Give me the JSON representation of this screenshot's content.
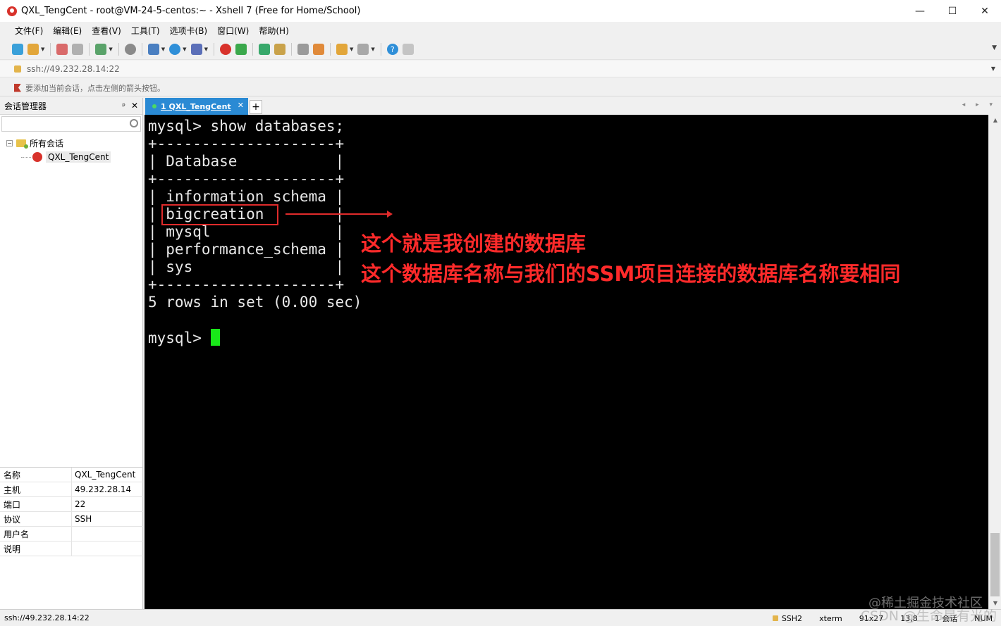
{
  "window": {
    "title": "QXL_TengCent - root@VM-24-5-centos:~ - Xshell 7 (Free for Home/School)",
    "controls": [
      "—",
      "☐",
      "✕"
    ]
  },
  "menu": [
    "文件(F)",
    "编辑(E)",
    "查看(V)",
    "工具(T)",
    "选项卡(B)",
    "窗口(W)",
    "帮助(H)"
  ],
  "toolbar": {
    "icons": [
      "new-session-icon",
      "open-folder-icon",
      "disconnect-icon",
      "reconnect-icon",
      "session-settings-icon",
      "find-icon",
      "transfer-icon",
      "globe-icon",
      "font-icon",
      "xftp-icon",
      "xmanager-icon",
      "fullscreen-icon",
      "lock-icon",
      "keyboard-icon",
      "highlight-icon",
      "new-tab-icon",
      "layout-icon",
      "help-icon",
      "chat-icon"
    ],
    "accent": "#2a8ad4"
  },
  "address": {
    "value": "ssh://49.232.28.14:22"
  },
  "hint": {
    "text": "要添加当前会话，点击左侧的箭头按钮。"
  },
  "session_manager": {
    "title": "会话管理器",
    "pin": "ᵖ",
    "close": "✕",
    "search_placeholder": "",
    "tree": {
      "root": "所有会话",
      "toggle": "−",
      "session": "QXL_TengCent"
    },
    "properties": [
      {
        "key": "名称",
        "value": "QXL_TengCent"
      },
      {
        "key": "主机",
        "value": "49.232.28.14"
      },
      {
        "key": "端口",
        "value": "22"
      },
      {
        "key": "协议",
        "value": "SSH"
      },
      {
        "key": "用户名",
        "value": ""
      },
      {
        "key": "说明",
        "value": ""
      }
    ]
  },
  "tabs": {
    "active": "1 QXL_TengCent",
    "close": "✕",
    "add": "+",
    "nav": "◂ ▸ ▾"
  },
  "terminal": {
    "lines": [
      "mysql> show databases;",
      "+--------------------+",
      "| Database           |",
      "+--------------------+",
      "| information_schema |",
      "| bigcreation        |",
      "| mysql              |",
      "| performance_schema |",
      "| sys                |",
      "+--------------------+",
      "5 rows in set (0.00 sec)",
      "",
      "mysql> "
    ],
    "annotation_line1": "这个就是我创建的数据库",
    "annotation_line2": "这个数据库名称与我们的SSM项目连接的数据库名称要相同",
    "annotation_color": "#ff2a2a",
    "cursor_color": "#19e819"
  },
  "statusbar": {
    "address": "ssh://49.232.28.14:22",
    "protocol": "SSH2",
    "term": "xterm",
    "size": "91x27",
    "position": "13,8",
    "sessions": "1 会话",
    "num": "NUM"
  },
  "watermark": {
    "line1": "@稀土掘金技术社区",
    "line2": "CSDN @生命是有光的"
  }
}
